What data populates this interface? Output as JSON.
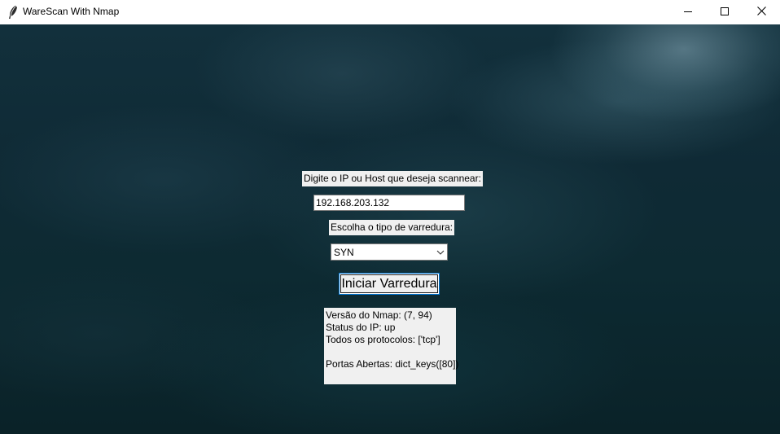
{
  "window": {
    "title": "WareScan With Nmap",
    "icon": "feather-icon",
    "controls": {
      "minimize": "minimize-icon",
      "maximize": "maximize-icon",
      "close": "close-icon"
    }
  },
  "form": {
    "host_label": "Digite o IP ou Host que deseja scannear:",
    "host_value": "192.168.203.132",
    "scan_type_label": "Escolha o tipo de varredura:",
    "scan_type_value": "SYN",
    "start_button_label": "Iniciar Varredura"
  },
  "results": {
    "nmap_version": "Versão do Nmap: (7, 94)",
    "ip_status": "Status do IP: up",
    "protocols": "Todos os protocolos: ['tcp']",
    "blank": "",
    "open_ports": "Portas Abertas: dict_keys([80])"
  },
  "colors": {
    "background_dark": "#0f2a35",
    "widget_bg": "#f0f0f0",
    "focus_border": "#0078d7"
  }
}
